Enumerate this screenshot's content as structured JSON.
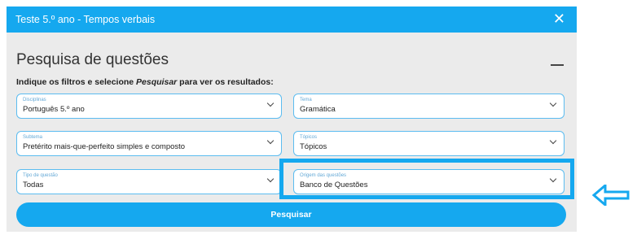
{
  "modal": {
    "title": "Teste 5.º ano - Tempos verbais",
    "close_icon": "close-icon"
  },
  "search": {
    "title": "Pesquisa de questões",
    "instructions_before": "Indique os filtros e selecione ",
    "instructions_em": "Pesquisar",
    "instructions_after": " para ver os resultados:",
    "collapse_icon": "minus-icon",
    "button_label": "Pesquisar"
  },
  "filters": {
    "disciplinas": {
      "label": "Disciplinas",
      "value": "Português 5.º ano"
    },
    "tema": {
      "label": "Tema",
      "value": "Gramática"
    },
    "subtema": {
      "label": "Subtema",
      "value": "Pretérito mais-que-perfeito simples e composto"
    },
    "topicos": {
      "label": "Tópicos",
      "value": "Tópicos"
    },
    "tipo": {
      "label": "Tipo de questão",
      "value": "Todas"
    },
    "origem": {
      "label": "Origem das questões",
      "value": "Banco de Questões"
    }
  },
  "annotation": {
    "color": "#15a8ef",
    "icon": "arrow-left-icon"
  },
  "colors": {
    "accent": "#15a8ef",
    "panel_background": "#ebebeb",
    "field_border": "#5bbcf0"
  }
}
